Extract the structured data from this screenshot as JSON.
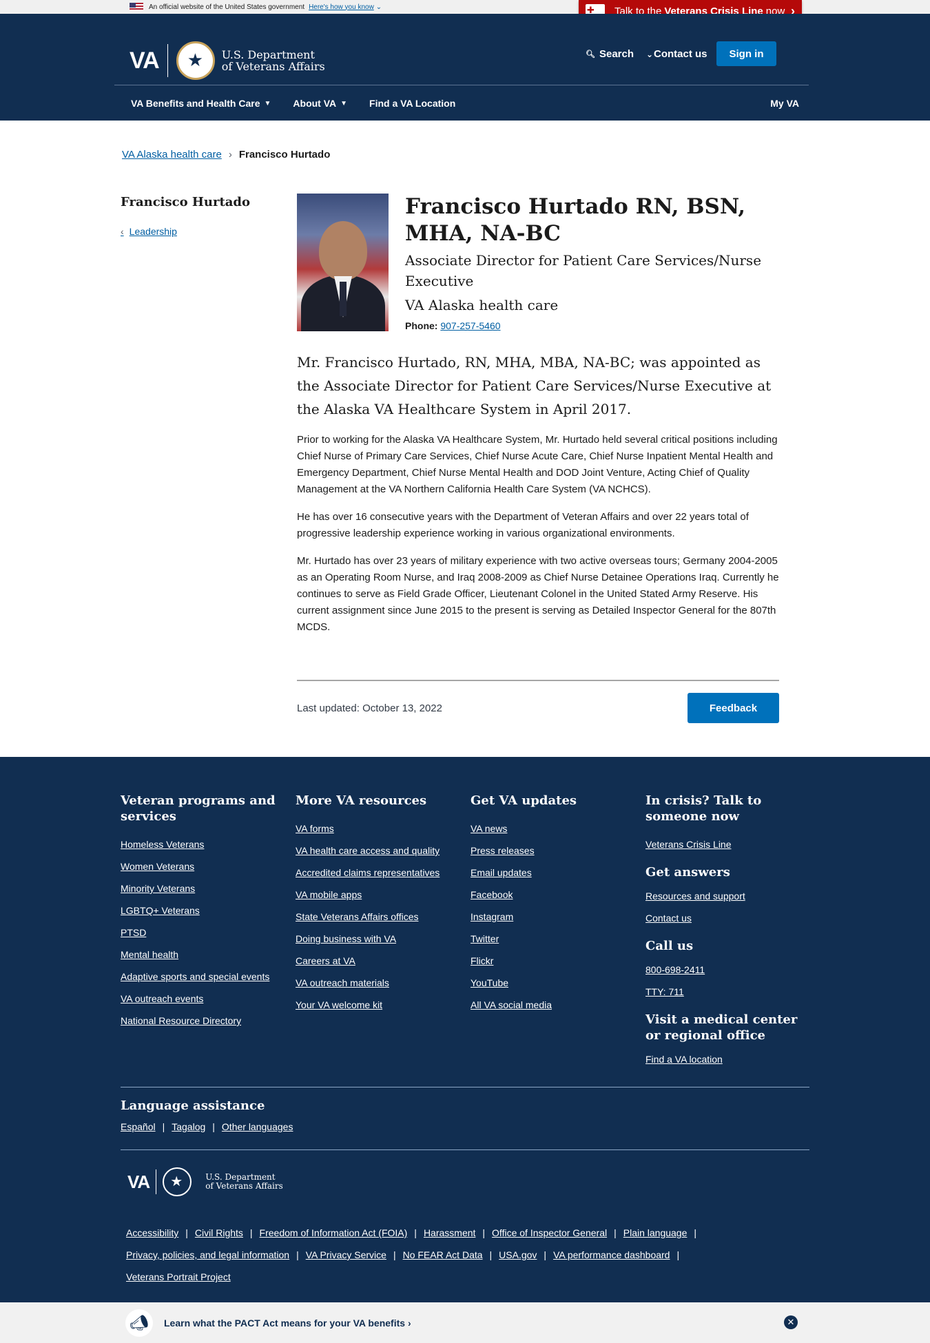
{
  "gov_banner": {
    "text": "An official website of the United States government",
    "link": "Here's how you know"
  },
  "crisis": {
    "prefix": "Talk to the",
    "bold": "Veterans Crisis Line",
    "suffix": "now"
  },
  "header": {
    "logo_letters": "VA",
    "dept_line1": "U.S. Department",
    "dept_line2": "of Veterans Affairs",
    "search": "Search",
    "contact": "Contact us",
    "signin": "Sign in"
  },
  "nav": {
    "items": [
      "VA Benefits and Health Care",
      "About VA",
      "Find a VA Location"
    ],
    "my_va": "My VA"
  },
  "breadcrumb": {
    "parent": "VA Alaska health care",
    "current": "Francisco Hurtado"
  },
  "sidenav": {
    "title": "Francisco Hurtado",
    "back": "Leadership"
  },
  "profile": {
    "name": "Francisco Hurtado RN, BSN, MHA, NA-BC",
    "role": "Associate Director for Patient Care Services/Nurse Executive",
    "facility": "VA Alaska health care",
    "phone_label": "Phone:",
    "phone": "907-257-5460",
    "intro": "Mr. Francisco Hurtado, RN, MHA, MBA, NA-BC; was appointed as the Associate Director for Patient Care Services/Nurse Executive at the Alaska VA Healthcare System in April 2017.",
    "paragraphs": [
      "Prior to working for the Alaska VA Healthcare System, Mr. Hurtado held several critical positions including Chief Nurse of Primary Care Services, Chief Nurse Acute Care, Chief Nurse Inpatient Mental Health and Emergency Department, Chief Nurse Mental Health and DOD Joint Venture, Acting Chief of Quality Management at the VA Northern California Health Care System (VA NCHCS).",
      "He has over 16 consecutive years with the Department of Veteran Affairs and over 22 years total of progressive leadership experience working in various organizational environments.",
      "Mr. Hurtado has over 23 years of military experience with two active overseas tours; Germany 2004-2005 as an Operating Room Nurse, and Iraq 2008-2009 as Chief Nurse Detainee Operations Iraq. Currently he continues to serve as Field Grade Officer, Lieutenant Colonel in the United Stated Army Reserve. His current assignment since June 2015 to the present is serving as Detailed Inspector General for the 807th MCDS."
    ]
  },
  "page_footer": {
    "updated": "Last updated: October 13, 2022",
    "feedback": "Feedback"
  },
  "footer": {
    "col1": {
      "title": "Veteran programs and services",
      "links": [
        "Homeless Veterans",
        "Women Veterans",
        "Minority Veterans",
        "LGBTQ+ Veterans",
        "PTSD",
        "Mental health",
        "Adaptive sports and special events",
        "VA outreach events",
        "National Resource Directory"
      ]
    },
    "col2": {
      "title": "More VA resources",
      "links": [
        "VA forms",
        "VA health care access and quality",
        "Accredited claims representatives",
        "VA mobile apps",
        "State Veterans Affairs offices",
        "Doing business with VA",
        "Careers at VA",
        "VA outreach materials",
        "Your VA welcome kit"
      ]
    },
    "col3": {
      "title": "Get VA updates",
      "links": [
        "VA news",
        "Press releases",
        "Email updates",
        "Facebook",
        "Instagram",
        "Twitter",
        "Flickr",
        "YouTube",
        "All VA social media"
      ]
    },
    "col4": {
      "crisis_title": "In crisis? Talk to someone now",
      "crisis_link": "Veterans Crisis Line",
      "answers_title": "Get answers",
      "answers_links": [
        "Resources and support",
        "Contact us"
      ],
      "call_title": "Call us",
      "call_links": [
        "800-698-2411",
        "TTY: 711"
      ],
      "visit_title": "Visit a medical center or regional office",
      "visit_link": "Find a VA location"
    },
    "language": {
      "title": "Language assistance",
      "links": [
        "Español",
        "Tagalog",
        "Other languages"
      ]
    },
    "bottom_links": [
      "Accessibility",
      "Civil Rights",
      "Freedom of Information Act (FOIA)",
      "Harassment",
      "Office of Inspector General",
      "Plain language",
      "Privacy, policies, and legal information",
      "VA Privacy Service",
      "No FEAR Act Data",
      "USA.gov",
      "VA performance dashboard",
      "Veterans Portrait Project"
    ]
  },
  "pact": {
    "text": "Learn what the PACT Act means for your VA benefits ›"
  },
  "colors": {
    "navy": "#112e51",
    "link": "#005ea2",
    "button": "#0071bb",
    "crisis": "#b50909"
  }
}
